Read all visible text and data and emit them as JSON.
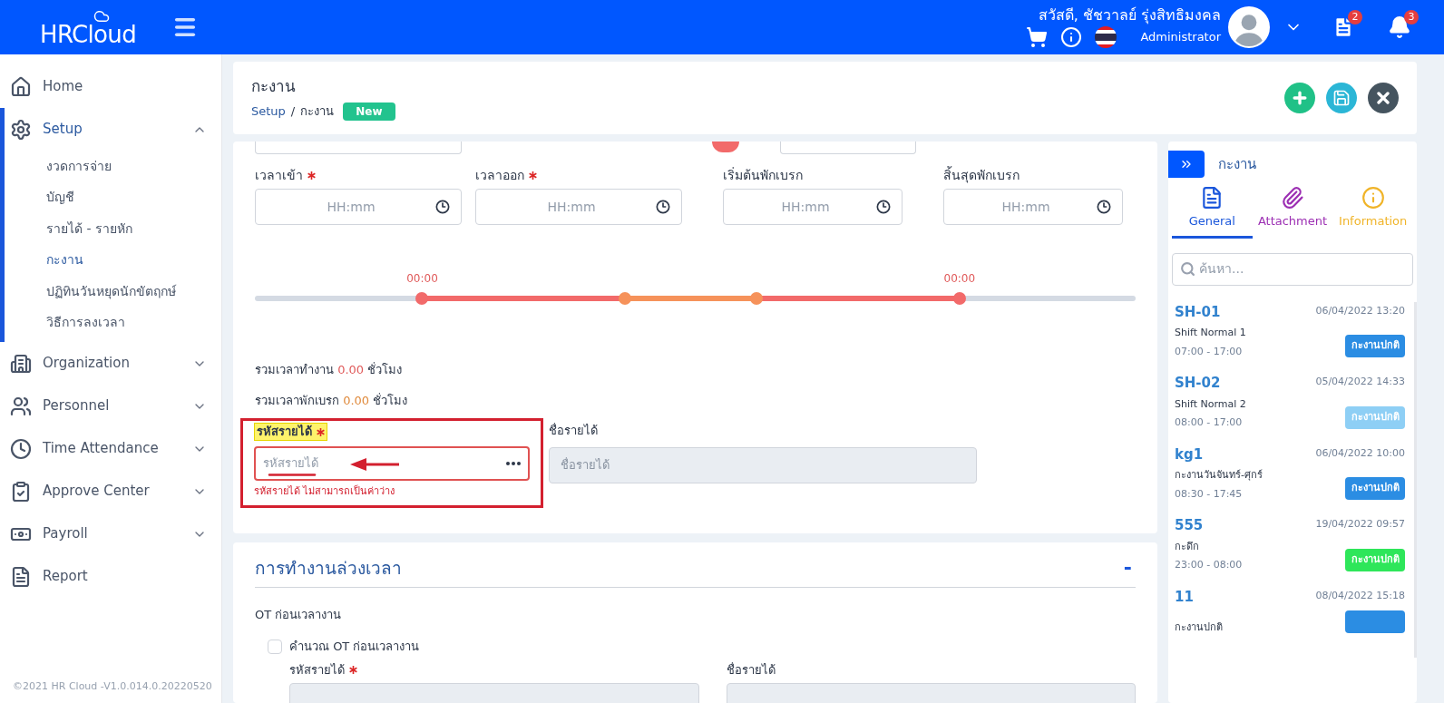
{
  "header": {
    "logo": "HRCloud",
    "greeting": "สวัสดี, ชัชวาลย์ รุ่งสิทธิมงคล",
    "role": "Administrator",
    "doc_badge": "2",
    "bell_badge": "3"
  },
  "sidebar": {
    "items": [
      {
        "label": "Home",
        "kind": "link",
        "selected": false
      },
      {
        "label": "Setup",
        "kind": "group",
        "expanded": true,
        "selected": true,
        "children": [
          {
            "label": "งวดการจ่าย",
            "selected": false
          },
          {
            "label": "บัญชี",
            "selected": false
          },
          {
            "label": "รายได้ - รายหัก",
            "selected": false
          },
          {
            "label": "กะงาน",
            "selected": true
          },
          {
            "label": "ปฏิทินวันหยุดนักขัตฤกษ์",
            "selected": false
          },
          {
            "label": "วิธีการลงเวลา",
            "selected": false
          }
        ]
      },
      {
        "label": "Organization",
        "kind": "group",
        "expanded": false,
        "selected": false
      },
      {
        "label": "Personnel",
        "kind": "group",
        "expanded": false,
        "selected": false
      },
      {
        "label": "Time Attendance",
        "kind": "group",
        "expanded": false,
        "selected": false
      },
      {
        "label": "Approve Center",
        "kind": "group",
        "expanded": false,
        "selected": false
      },
      {
        "label": "Payroll",
        "kind": "group",
        "expanded": false,
        "selected": false
      },
      {
        "label": "Report",
        "kind": "link",
        "selected": false
      }
    ],
    "footer": "©2021 HR Cloud -V1.0.014.0.20220520"
  },
  "page": {
    "title": "กะงาน",
    "breadcrumb": [
      "Setup",
      "กะงาน"
    ],
    "breadcrumb_separator": "/",
    "status_badge": "New"
  },
  "time_fields": [
    {
      "label": "เวลาเข้า",
      "required": true,
      "placeholder": "HH:mm"
    },
    {
      "label": "เวลาออก",
      "required": true,
      "placeholder": "HH:mm"
    },
    {
      "label": "เริ่มต้นพักเบรก",
      "required": false,
      "placeholder": "HH:mm"
    },
    {
      "label": "สิ้นสุดพักเบรก",
      "required": false,
      "placeholder": "HH:mm"
    }
  ],
  "timeline": {
    "handles": [
      {
        "kind": "work",
        "level": 0.19,
        "label": "00:00"
      },
      {
        "kind": "break",
        "level": 0.42
      },
      {
        "kind": "break",
        "level": 0.57
      },
      {
        "kind": "work",
        "level": 0.8,
        "label": "00:00"
      }
    ]
  },
  "totals": [
    {
      "label": "รวมเวลาทำงาน",
      "value": "0.00",
      "unit": "ชั่วโมง",
      "kind": "work"
    },
    {
      "label": "รวมเวลาพักเบรก",
      "value": "0.00",
      "unit": "ชั่วโมง",
      "kind": "break"
    }
  ],
  "income_code": {
    "label": "รหัสรายได้",
    "required": true,
    "placeholder": "รหัสรายได้",
    "error": "รหัสรายได้ ไม่สามารถเป็นค่าว่าง"
  },
  "income_name": {
    "label": "ชื่อรายได้",
    "placeholder": "ชื่อรายได้",
    "disabled": true
  },
  "overtime": {
    "title": "การทำงานล่วงเวลา",
    "collapse": "-",
    "subtitle": "OT ก่อนเวลางาน",
    "checkbox": {
      "label": "คำนวณ OT ก่อนเวลางาน",
      "checked": false
    },
    "fields": [
      {
        "label": "รหัสรายได้",
        "required": true
      },
      {
        "label": "ชื่อรายได้",
        "required": false
      }
    ]
  },
  "right_panel": {
    "title": "กะงาน",
    "tabs": [
      {
        "label": "General",
        "selected": true,
        "color": "#1a56db"
      },
      {
        "label": "Attachment",
        "selected": false,
        "color": "#9c2fb3"
      },
      {
        "label": "Information",
        "selected": false,
        "color": "#f0b429"
      }
    ],
    "search": {
      "placeholder": "ค้นหา..."
    },
    "items": [
      {
        "code": "SH-01",
        "date": "06/04/2022 13:20",
        "name": "Shift Normal 1",
        "time": "07:00 - 17:00",
        "badge": "กะงานปกติ",
        "color": "#2b8de3"
      },
      {
        "code": "SH-02",
        "date": "05/04/2022 14:33",
        "name": "Shift Normal 2",
        "time": "08:00 - 17:00",
        "badge": "กะงานปกติ",
        "color": "#8ecff5"
      },
      {
        "code": "kg1",
        "date": "06/04/2022 10:00",
        "name": "กะงานวันจันทร์-ศุกร์",
        "time": "08:30 - 17:45",
        "badge": "กะงานปกติ",
        "color": "#2b8de3"
      },
      {
        "code": "555",
        "date": "19/04/2022 09:57",
        "name": "กะดึก",
        "time": "23:00 - 08:00",
        "badge": "กะงานปกติ",
        "color": "#2ee65a"
      },
      {
        "code": "11",
        "date": "08/04/2022 15:18",
        "name": "กะงานปกติ",
        "color": "#2b8de3"
      }
    ]
  }
}
